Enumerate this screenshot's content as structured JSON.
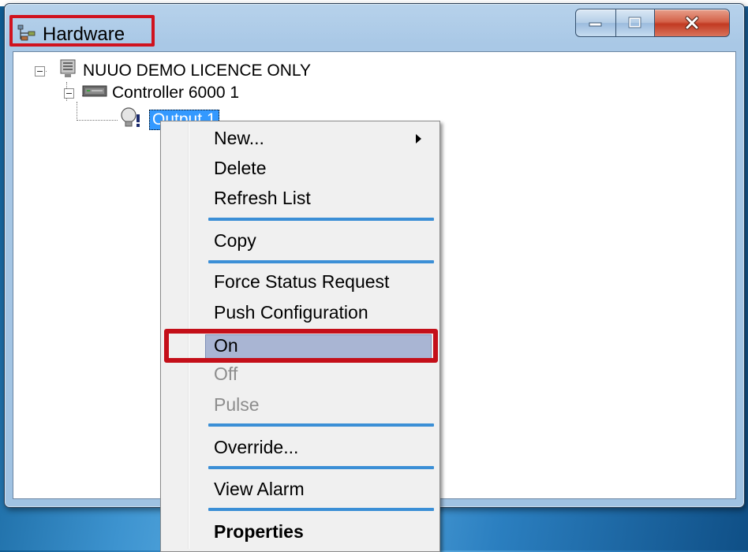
{
  "window": {
    "title": "Hardware",
    "icon": "hardware-tree-icon"
  },
  "colors": {
    "highlight_red": "#d0121e",
    "selection_blue": "#3399ff",
    "separator_blue": "#3b8fd6",
    "menu_hover": "#a9b5d3"
  },
  "tree": {
    "root": {
      "label": "NUUO DEMO LICENCE ONLY",
      "icon": "server-icon",
      "expanded": true
    },
    "controller": {
      "label": "Controller 6000 1",
      "icon": "controller-icon",
      "expanded": true
    },
    "output": {
      "label": "Output 1",
      "icon": "bulb-output-icon",
      "selected": true
    }
  },
  "context_menu": {
    "items": [
      {
        "label": "New...",
        "submenu": true
      },
      {
        "label": "Delete"
      },
      {
        "label": "Refresh List"
      },
      {
        "label": "Copy"
      },
      {
        "label": "Force Status Request"
      },
      {
        "label": "Push Configuration"
      },
      {
        "label": "On",
        "highlighted": true
      },
      {
        "label": "Off",
        "disabled": true
      },
      {
        "label": "Pulse",
        "disabled": true
      },
      {
        "label": "Override..."
      },
      {
        "label": "View Alarm"
      },
      {
        "label": "Properties",
        "bold": true
      }
    ]
  }
}
